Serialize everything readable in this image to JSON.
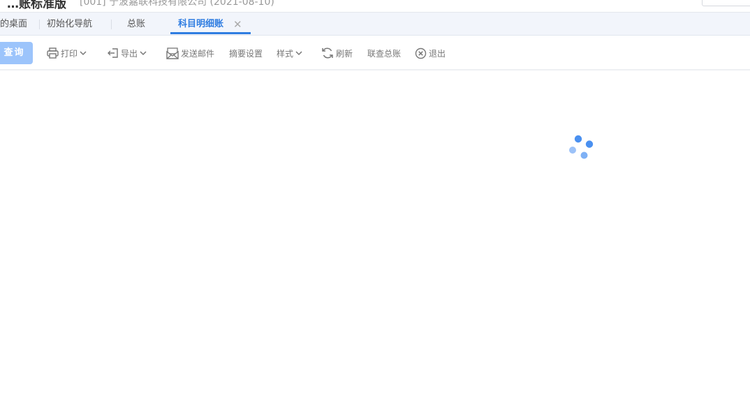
{
  "header": {
    "app_title": "…账标准版",
    "company_info": "[001] 宁波嘉联科技有限公司 (2021-08-10)"
  },
  "tabs": [
    {
      "label": "的桌面"
    },
    {
      "label": "初始化导航"
    },
    {
      "label": "总账"
    },
    {
      "label": "科目明细账",
      "active": true
    }
  ],
  "toolbar": {
    "query": "查询",
    "print": "打印",
    "export": "导出",
    "send_mail": "发送邮件",
    "summary_settings": "摘要设置",
    "style": "样式",
    "refresh": "刷新",
    "linked_ledger": "联查总账",
    "exit": "退出"
  },
  "icons": {
    "print": "printer-icon",
    "export": "export-icon",
    "send_mail": "mail-icon",
    "refresh": "refresh-icon",
    "exit": "close-circle-icon",
    "tab_close": "close-icon",
    "loading": "loading-spinner-icon"
  },
  "colors": {
    "accent": "#2f7de1",
    "query_button": "#9cc4fb",
    "spinner": "#4a90f0"
  }
}
